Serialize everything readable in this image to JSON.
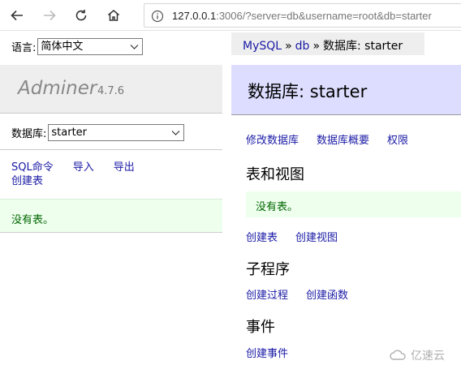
{
  "browser": {
    "url_host": "127.0.0.1",
    "url_rest": ":3006/?server=db&username=root&db=starter"
  },
  "sidebar": {
    "language_label": "语言:",
    "language_value": "简体中文",
    "app_name": "Adminer",
    "app_version": "4.7.6",
    "db_label": "数据库:",
    "db_value": "starter",
    "links": {
      "sql": "SQL命令",
      "import": "导入",
      "export": "导出",
      "create_table": "创建表"
    },
    "message": "没有表。"
  },
  "breadcrumb": {
    "server": "MySQL",
    "sep1": "»",
    "db": "db",
    "sep2": "»",
    "current": "数据库: starter"
  },
  "main": {
    "title": "数据库: starter",
    "top_links": {
      "alter_db": "修改数据库",
      "db_schema": "数据库概要",
      "privileges": "权限"
    },
    "tables_heading": "表和视图",
    "tables_message": "没有表。",
    "tables_links": {
      "create_table": "创建表",
      "create_view": "创建视图"
    },
    "routines_heading": "子程序",
    "routines_links": {
      "create_procedure": "创建过程",
      "create_function": "创建函数"
    },
    "events_heading": "事件",
    "events_links": {
      "create_event": "创建事件"
    }
  },
  "watermark": {
    "text": "亿速云"
  },
  "colors": {
    "link": "#1a1aa6",
    "message_bg": "#eeffee",
    "message_text": "#006600",
    "header_bg": "#ddddff",
    "sidebar_header_bg": "#eeeeee"
  }
}
